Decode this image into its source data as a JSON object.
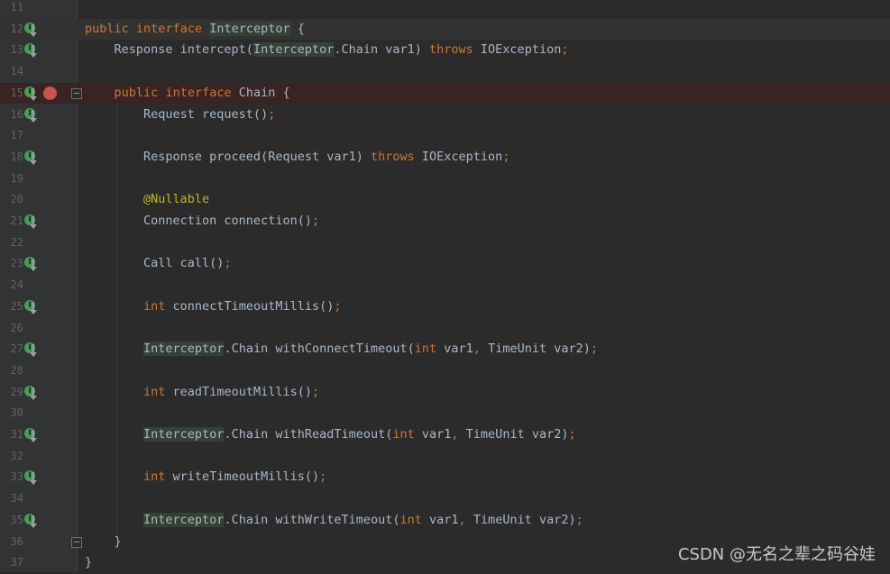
{
  "editor": {
    "lines": [
      {
        "num": "11",
        "tokens": [],
        "icons": []
      },
      {
        "num": "12",
        "tokens": [
          {
            "t": "public",
            "c": "kw"
          },
          {
            "t": " "
          },
          {
            "t": "interface",
            "c": "kw"
          },
          {
            "t": " "
          },
          {
            "t": "Interceptor",
            "c": "hl"
          },
          {
            "t": " {"
          }
        ],
        "icons": [
          "impl"
        ],
        "caret": true
      },
      {
        "num": "13",
        "tokens": [
          {
            "t": "    Response intercept("
          },
          {
            "t": "Interceptor",
            "c": "hl"
          },
          {
            "t": ".Chain var1) "
          },
          {
            "t": "throws",
            "c": "kw"
          },
          {
            "t": " IOException"
          },
          {
            "t": ";",
            "c": "kw"
          }
        ],
        "icons": [
          "impl"
        ]
      },
      {
        "num": "14",
        "tokens": [],
        "icons": []
      },
      {
        "num": "15",
        "tokens": [
          {
            "t": "    "
          },
          {
            "t": "public",
            "c": "kw"
          },
          {
            "t": " "
          },
          {
            "t": "interface",
            "c": "kw"
          },
          {
            "t": " Chain {"
          }
        ],
        "icons": [
          "impl",
          "breakpoint"
        ],
        "fold": true,
        "breakpoint_line": true
      },
      {
        "num": "16",
        "tokens": [
          {
            "t": "        Request request()"
          },
          {
            "t": ";",
            "c": "kw"
          }
        ],
        "icons": [
          "impl"
        ]
      },
      {
        "num": "17",
        "tokens": [],
        "icons": []
      },
      {
        "num": "18",
        "tokens": [
          {
            "t": "        Response proceed(Request var1) "
          },
          {
            "t": "throws",
            "c": "kw"
          },
          {
            "t": " IOException"
          },
          {
            "t": ";",
            "c": "kw"
          }
        ],
        "icons": [
          "impl"
        ]
      },
      {
        "num": "19",
        "tokens": [],
        "icons": []
      },
      {
        "num": "20",
        "tokens": [
          {
            "t": "        "
          },
          {
            "t": "@Nullable",
            "c": "ann"
          }
        ],
        "icons": []
      },
      {
        "num": "21",
        "tokens": [
          {
            "t": "        Connection connection()"
          },
          {
            "t": ";",
            "c": "kw"
          }
        ],
        "icons": [
          "impl"
        ]
      },
      {
        "num": "22",
        "tokens": [],
        "icons": []
      },
      {
        "num": "23",
        "tokens": [
          {
            "t": "        Call call()"
          },
          {
            "t": ";",
            "c": "kw"
          }
        ],
        "icons": [
          "impl"
        ]
      },
      {
        "num": "24",
        "tokens": [],
        "icons": []
      },
      {
        "num": "25",
        "tokens": [
          {
            "t": "        "
          },
          {
            "t": "int",
            "c": "kw"
          },
          {
            "t": " connectTimeoutMillis()"
          },
          {
            "t": ";",
            "c": "kw"
          }
        ],
        "icons": [
          "impl"
        ]
      },
      {
        "num": "26",
        "tokens": [],
        "icons": []
      },
      {
        "num": "27",
        "tokens": [
          {
            "t": "        "
          },
          {
            "t": "Interceptor",
            "c": "hl"
          },
          {
            "t": ".Chain withConnectTimeout("
          },
          {
            "t": "int",
            "c": "kw"
          },
          {
            "t": " var1"
          },
          {
            "t": ",",
            "c": "kw"
          },
          {
            "t": " TimeUnit var2)"
          },
          {
            "t": ";",
            "c": "kw"
          }
        ],
        "icons": [
          "impl"
        ]
      },
      {
        "num": "28",
        "tokens": [],
        "icons": []
      },
      {
        "num": "29",
        "tokens": [
          {
            "t": "        "
          },
          {
            "t": "int",
            "c": "kw"
          },
          {
            "t": " readTimeoutMillis()"
          },
          {
            "t": ";",
            "c": "kw"
          }
        ],
        "icons": [
          "impl"
        ]
      },
      {
        "num": "30",
        "tokens": [],
        "icons": []
      },
      {
        "num": "31",
        "tokens": [
          {
            "t": "        "
          },
          {
            "t": "Interceptor",
            "c": "hl"
          },
          {
            "t": ".Chain withReadTimeout("
          },
          {
            "t": "int",
            "c": "kw"
          },
          {
            "t": " var1"
          },
          {
            "t": ",",
            "c": "kw"
          },
          {
            "t": " TimeUnit var2)"
          },
          {
            "t": ";",
            "c": "kw"
          }
        ],
        "icons": [
          "impl"
        ]
      },
      {
        "num": "32",
        "tokens": [],
        "icons": []
      },
      {
        "num": "33",
        "tokens": [
          {
            "t": "        "
          },
          {
            "t": "int",
            "c": "kw"
          },
          {
            "t": " writeTimeoutMillis()"
          },
          {
            "t": ";",
            "c": "kw"
          }
        ],
        "icons": [
          "impl"
        ]
      },
      {
        "num": "34",
        "tokens": [],
        "icons": []
      },
      {
        "num": "35",
        "tokens": [
          {
            "t": "        "
          },
          {
            "t": "Interceptor",
            "c": "hl"
          },
          {
            "t": ".Chain withWriteTimeout("
          },
          {
            "t": "int",
            "c": "kw"
          },
          {
            "t": " var1"
          },
          {
            "t": ",",
            "c": "kw"
          },
          {
            "t": " TimeUnit var2)"
          },
          {
            "t": ";",
            "c": "kw"
          }
        ],
        "icons": [
          "impl"
        ]
      },
      {
        "num": "36",
        "tokens": [
          {
            "t": "    }"
          }
        ],
        "icons": [],
        "fold": true
      },
      {
        "num": "37",
        "tokens": [
          {
            "t": "}"
          }
        ],
        "icons": []
      }
    ]
  },
  "icons": {
    "implements_marker": "implements-down-arrow-icon",
    "breakpoint": "breakpoint-icon",
    "fold": "fold-icon",
    "impl_glyph": "I"
  },
  "colors": {
    "background": "#2b2b2b",
    "gutter": "#313335",
    "keyword": "#cc7832",
    "annotation": "#bbb529",
    "text": "#a9b7c6",
    "breakpoint": "#c75450",
    "highlight": "#344134"
  },
  "watermark": "CSDN @无名之辈之码谷娃"
}
